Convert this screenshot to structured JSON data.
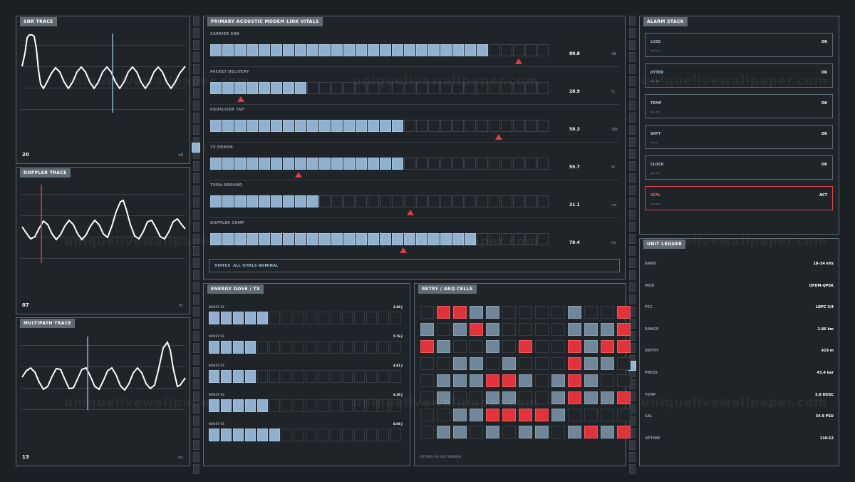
{
  "traces": [
    {
      "title": "SNR TRACE",
      "value": "20",
      "unit": "dB",
      "cursor_color": "#8fb0cf"
    },
    {
      "title": "DOPPLER TRACE",
      "value": "07",
      "unit": "Hz",
      "cursor_color": "#e23c3c"
    },
    {
      "title": "MULTIPATH TRACE",
      "value": "13",
      "unit": "ms",
      "cursor_color": "#8fb0cf"
    }
  ],
  "vitals": {
    "title": "PRIMARY  ACOUSTIC MODEM LINK VITALS",
    "status_label": "STATUS",
    "status_text": "ALL VITALS NOMINAL",
    "rows": [
      {
        "label": "CARRIER SNR",
        "value": "80.8",
        "unit": "dB",
        "fill": 0.82,
        "marker": 0.91
      },
      {
        "label": "PACKET DELIVERY",
        "value": "28.9",
        "unit": "%",
        "fill": 0.29,
        "marker": 0.09
      },
      {
        "label": "EQUALISER TAP",
        "value": "58.3",
        "unit": "TAP",
        "fill": 0.57,
        "marker": 0.85
      },
      {
        "label": "TX POWER",
        "value": "55.7",
        "unit": "W",
        "fill": 0.57,
        "marker": 0.26
      },
      {
        "label": "TURN-AROUND",
        "value": "31.1",
        "unit": "ms",
        "fill": 0.32,
        "marker": 0.59
      },
      {
        "label": "DOPPLER COMP",
        "value": "79.4",
        "unit": "Hz",
        "fill": 0.79,
        "marker": 0.57
      }
    ]
  },
  "energy": {
    "title": "ENERGY DOSE / TX",
    "rows": [
      {
        "label": "BURST 01",
        "value": "2.69 J",
        "on": 5
      },
      {
        "label": "BURST 02",
        "value": "5.76 J",
        "on": 4
      },
      {
        "label": "BURST 03",
        "value": "4.61 J",
        "on": 4
      },
      {
        "label": "BURST 04",
        "value": "6.38 J",
        "on": 5
      },
      {
        "label": "BURST 05",
        "value": "8.06 J",
        "on": 6
      }
    ]
  },
  "retry": {
    "title": "RETRY / ARQ CELLS",
    "footer": "RETRIES / 64-SLOT WINDOW",
    "grid": [
      "errbbeeeebeer",
      "bebrbeeeebbbr",
      "rbeebereerbrr",
      "eebbebeeerbbe",
      "ebbbrrbebrbee",
      "ebeebbeebrbbr",
      "eebbrrrrbeeee",
      "ebbebebbebrbr"
    ]
  },
  "alarms": {
    "title": "ALARM STACK",
    "items": [
      {
        "name": "LOSS",
        "state": "OK",
        "detail": "KEP 3/14",
        "active": false
      },
      {
        "name": "JITTER",
        "state": "OK",
        "detail": "NUL 480",
        "active": false
      },
      {
        "name": "TEMP",
        "state": "OK",
        "detail": "NUL 208",
        "active": false
      },
      {
        "name": "BATT",
        "state": "OK",
        "detail": "SKI 847",
        "active": false
      },
      {
        "name": "CLOCK",
        "state": "OK",
        "detail": "SOC 850",
        "active": false
      },
      {
        "name": "SEAL",
        "state": "ACT",
        "detail": "SYN 480",
        "active": true
      }
    ]
  },
  "ledger": {
    "title": "UNIT LEDGER",
    "rows": [
      {
        "key": "BAND",
        "value": "18–34 kHz"
      },
      {
        "key": "MOD",
        "value": "OFDM-QPSK"
      },
      {
        "key": "FEC",
        "value": "LDPC 3/4"
      },
      {
        "key": "RANGE",
        "value": "2.86 km"
      },
      {
        "key": "DEPTH",
        "value": "419 m"
      },
      {
        "key": "PRESS",
        "value": "43.4 bar"
      },
      {
        "key": "TEMP",
        "value": "5.8  DEGC"
      },
      {
        "key": "SAL",
        "value": "34.9 PSU"
      },
      {
        "key": "UPTIME",
        "value": "116:12"
      }
    ]
  },
  "watermark": "uniquelivewallpaper.com"
}
